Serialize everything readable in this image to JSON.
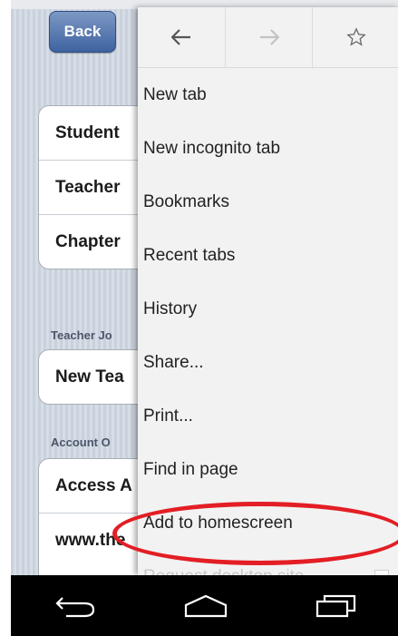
{
  "background_app": {
    "back_label": "Back",
    "group1_rows": [
      "Student",
      "Teacher",
      "Chapter"
    ],
    "section_teacher": "Teacher Jo",
    "group2_rows": [
      "New Tea"
    ],
    "section_account": "Account O",
    "group3_rows": [
      "Access A",
      "www.the"
    ]
  },
  "menu": {
    "toolbar": {
      "back_icon": "arrow-left-icon",
      "forward_icon": "arrow-right-icon",
      "bookmark_icon": "star-icon"
    },
    "items": [
      "New tab",
      "New incognito tab",
      "Bookmarks",
      "Recent tabs",
      "History",
      "Share...",
      "Print...",
      "Find in page",
      "Add to homescreen",
      "Request desktop site"
    ]
  },
  "annotation": {
    "highlight_color": "#e31e24"
  },
  "navbar": {
    "back_icon": "nav-back-icon",
    "home_icon": "nav-home-icon",
    "recents_icon": "nav-recents-icon"
  }
}
